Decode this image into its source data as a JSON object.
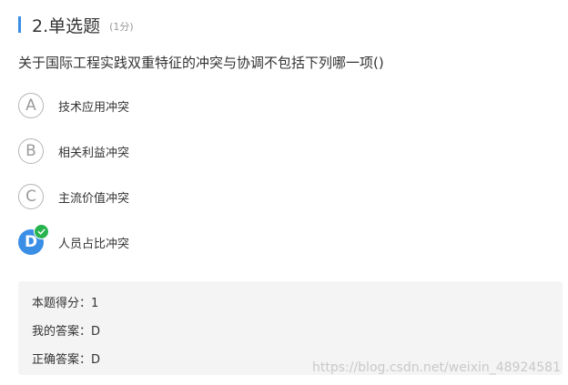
{
  "question": {
    "number_label": "2.单选题",
    "score_label": "(1分)",
    "stem": "关于国际工程实践双重特征的冲突与协调不包括下列哪一项()"
  },
  "options": [
    {
      "letter": "A",
      "text": "技术应用冲突",
      "selected": false
    },
    {
      "letter": "B",
      "text": "相关利益冲突",
      "selected": false
    },
    {
      "letter": "C",
      "text": "主流价值冲突",
      "selected": false
    },
    {
      "letter": "D",
      "text": "人员占比冲突",
      "selected": true
    }
  ],
  "result": {
    "score": "本题得分：1",
    "my_answer": "我的答案：D",
    "correct_answer": "正确答案：D"
  },
  "watermark": "https://blog.csdn.net/weixin_48924581",
  "colors": {
    "accent": "#3a8ee6",
    "correct": "#27b34d",
    "result_bg": "#f4f4f4"
  }
}
